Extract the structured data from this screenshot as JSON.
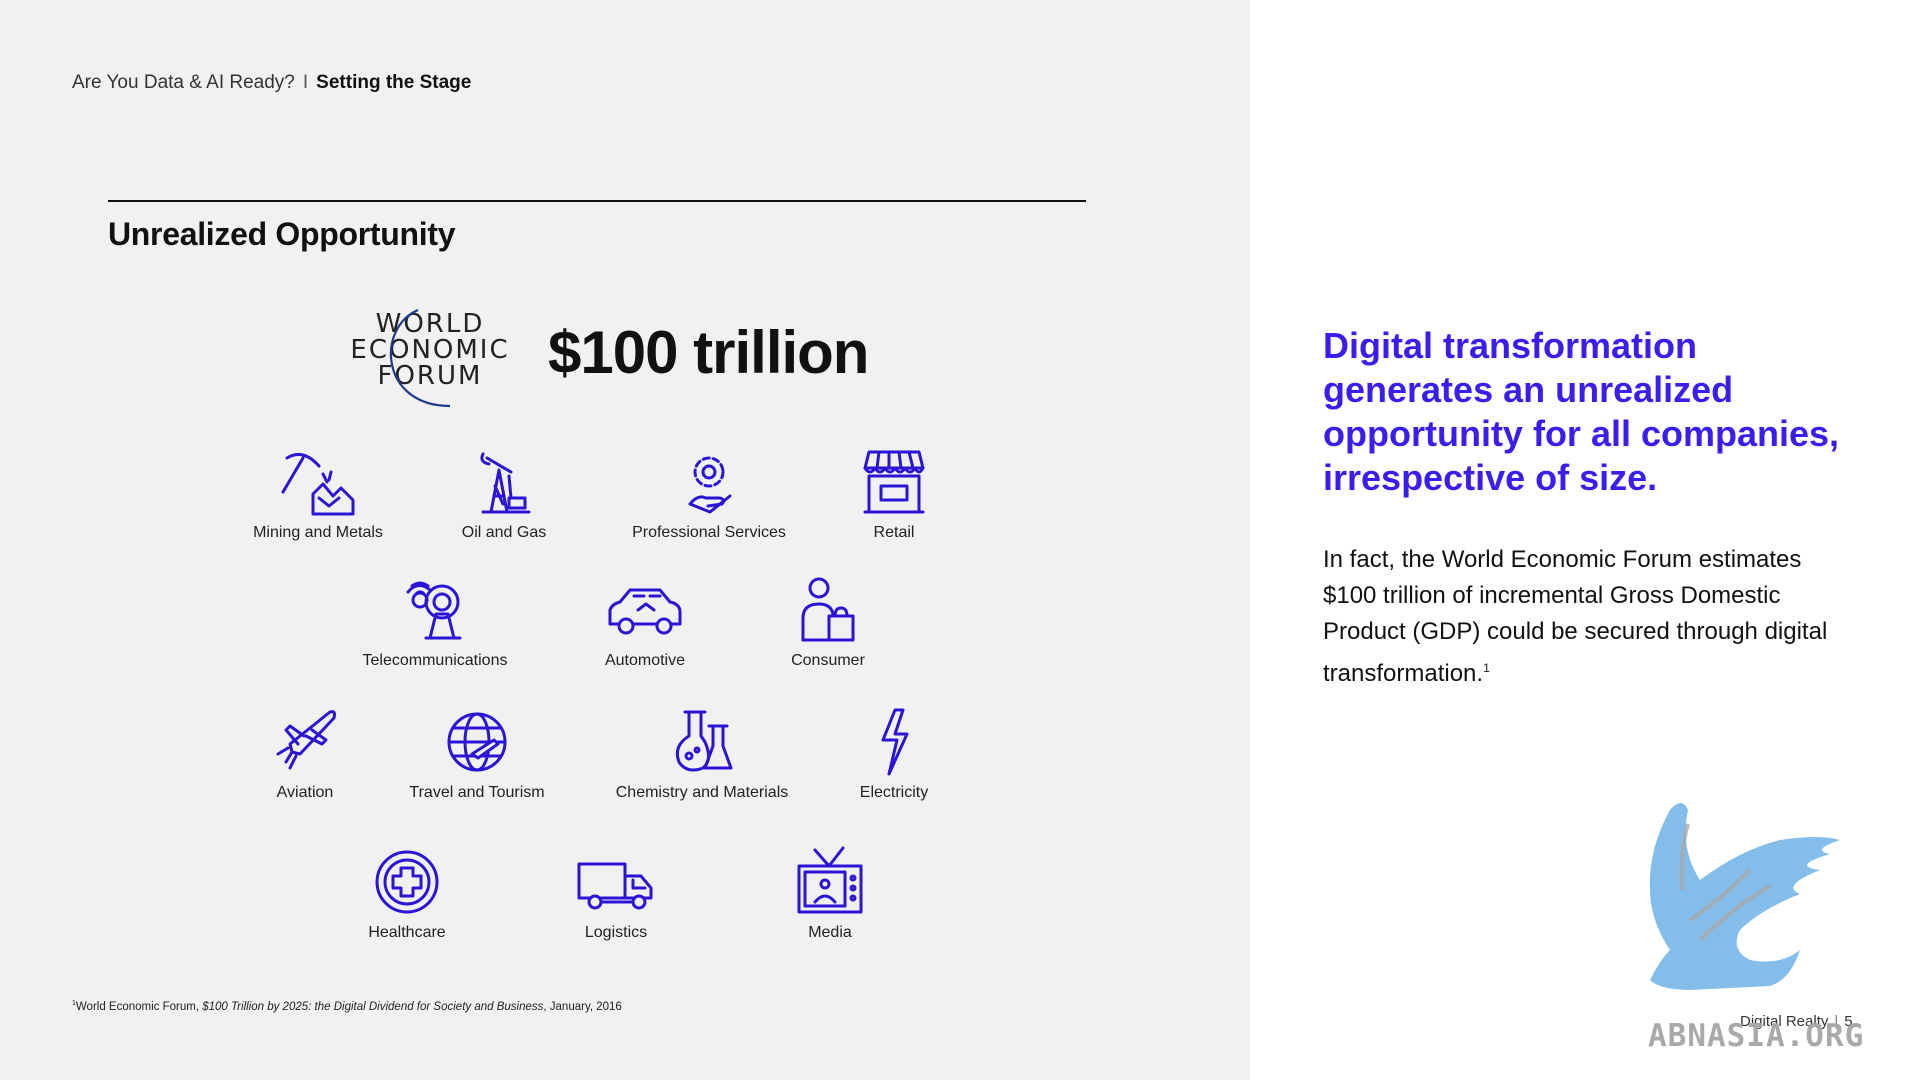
{
  "breadcrumb": {
    "section": "Are You Data & AI Ready?",
    "separator": "I",
    "current": "Setting the Stage"
  },
  "section_title": "Unrealized Opportunity",
  "logo": {
    "text_lines": [
      "WORLD",
      "ECONOMIC",
      "FORUM"
    ]
  },
  "big_number": "$100 trillion",
  "industries": [
    {
      "label": "Mining and Metals",
      "icon": "mining-icon"
    },
    {
      "label": "Oil and Gas",
      "icon": "oil-pump-icon"
    },
    {
      "label": "Professional Services",
      "icon": "gear-hand-icon"
    },
    {
      "label": "Retail",
      "icon": "store-icon"
    },
    {
      "label": "Telecommunications",
      "icon": "satellite-dish-icon"
    },
    {
      "label": "Automotive",
      "icon": "car-icon"
    },
    {
      "label": "Consumer",
      "icon": "person-bag-icon"
    },
    {
      "label": "Aviation",
      "icon": "airplane-icon"
    },
    {
      "label": "Travel and Tourism",
      "icon": "globe-plane-icon"
    },
    {
      "label": "Chemistry and Materials",
      "icon": "flask-icon"
    },
    {
      "label": "Electricity",
      "icon": "lightning-icon"
    },
    {
      "label": "Healthcare",
      "icon": "medical-cross-icon"
    },
    {
      "label": "Logistics",
      "icon": "truck-icon"
    },
    {
      "label": "Media",
      "icon": "tv-icon"
    }
  ],
  "footnote": {
    "marker": "1",
    "prefix": "World Economic Forum, ",
    "title": "$100 Trillion by 2025: the Digital Dividend for Society and Business",
    "suffix": ", January, 2016"
  },
  "headline": "Digital transformation generates an unrealized opportunity for all companies, irrespective of size.",
  "body": {
    "text": "In fact, the World Economic Forum estimates $100 trillion of incremental Gross Domestic Product (GDP) could be secured through digital transformation.",
    "footnote_marker": "1"
  },
  "footer": {
    "brand": "Digital Realty",
    "separator": "|",
    "page_number": "5"
  },
  "watermark": "ABNASIA.ORG",
  "colors": {
    "accent": "#3a1df0",
    "icon": "#2a14d6",
    "left_panel_bg": "#f1f1f1",
    "logo_arc": "#1f3a8a",
    "griffin": "#7db9e8",
    "watermark": "#a7a9ab"
  }
}
